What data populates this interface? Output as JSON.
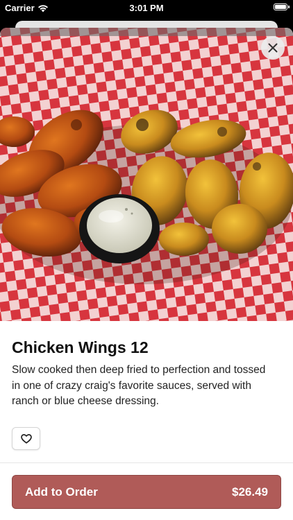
{
  "status_bar": {
    "carrier": "Carrier",
    "time": "3:01 PM",
    "icons": [
      "wifi-icon",
      "battery-icon"
    ]
  },
  "item": {
    "image_icon": "chicken-wings-photo",
    "title": "Chicken Wings 12",
    "description": "Slow cooked then deep fried to perfection and tossed in one of crazy craig's favorite sauces, served with ranch or blue cheese dressing."
  },
  "actions": {
    "close_icon": "close-icon",
    "favorite_icon": "heart-icon",
    "add_to_order_label": "Add to Order",
    "price": "$26.49"
  },
  "colors": {
    "accent": "#b05b58",
    "checker_red": "#d7353e",
    "checker_white": "#f6f2f0"
  }
}
